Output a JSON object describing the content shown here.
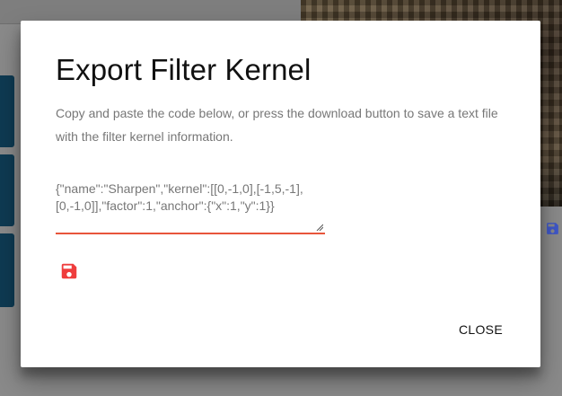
{
  "dialog": {
    "title": "Export Filter Kernel",
    "description": "Copy and paste the code below, or press the download button to save a text file with the filter kernel information.",
    "code": "{\"name\":\"Sharpen\",\"kernel\":[[0,-1,0],[-1,5,-1],[0,-1,0]],\"factor\":1,\"anchor\":{\"x\":1,\"y\":1}}",
    "download_icon": "save-icon",
    "close_label": "CLOSE"
  },
  "background": {
    "save_icon": "save-icon"
  },
  "colors": {
    "accent": "#ef3d3d",
    "underline": "#e8553b",
    "background_save_icon": "#3f57c8"
  }
}
